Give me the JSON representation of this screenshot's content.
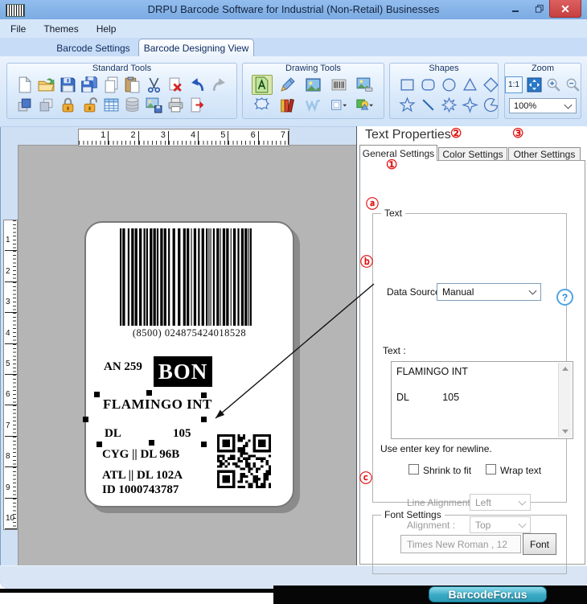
{
  "window": {
    "title": "DRPU Barcode Software for Industrial (Non-Retail) Businesses"
  },
  "menu": {
    "items": [
      "File",
      "Themes",
      "Help"
    ]
  },
  "main_tabs": {
    "barcode_settings": "Barcode Settings",
    "designing_view": "Barcode Designing View"
  },
  "toolbar": {
    "selected_tool": "text-tool",
    "zoom_ratio": "1:1",
    "zoom_level": "100%",
    "groups": [
      {
        "label": "Standard Tools",
        "icons": [
          "new-document",
          "open-file",
          "save",
          "save-as",
          "copy",
          "paste",
          "cut",
          "delete",
          "undo",
          "redo",
          "bring-to-front",
          "send-to-back",
          "lock",
          "unlock",
          "table",
          "database",
          "export-image",
          "print",
          "exit"
        ]
      },
      {
        "label": "Drawing Tools",
        "icons": [
          "text-tool",
          "pencil",
          "picture",
          "barcode-tool",
          "image-export",
          "shape-tool",
          "library",
          "watermark-tool",
          "frame-dropdown",
          "shapes-dropdown"
        ]
      },
      {
        "label": "Shapes",
        "icons": [
          "shape-rectangle",
          "shape-rounded-rectangle",
          "shape-ellipse",
          "shape-triangle",
          "shape-diamond",
          "shape-star",
          "shape-line",
          "shape-burst",
          "shape-star4",
          "shape-pacman"
        ]
      },
      {
        "label": "Zoom"
      }
    ]
  },
  "rulers": {
    "horizontal": [
      1,
      2,
      3,
      4,
      5,
      6,
      7
    ],
    "vertical": [
      1,
      2,
      3,
      4,
      5,
      6,
      7,
      8,
      9,
      10
    ]
  },
  "design_label": {
    "barcode_value": "(8500) 024875424018528",
    "line_an": "AN 259",
    "badge": "BON",
    "company": "FLAMINGO INT",
    "dl": "DL",
    "dl_num": "105",
    "line_cyg": "CYG || DL 96B",
    "line_atl": "ATL || DL 102A",
    "line_id": "ID 1000743787"
  },
  "panel": {
    "title": "Text Properties",
    "tabs": [
      "General Settings",
      "Color Settings",
      "Other Settings"
    ],
    "marks": {
      "n1": "①",
      "n2": "②",
      "n3": "③",
      "a": "ⓐ",
      "b": "ⓑ",
      "c": "ⓒ"
    },
    "text_group": {
      "label": "Text",
      "data_source_label": "Data Source :",
      "data_source_value": "Manual",
      "help_glyph": "?",
      "text_label": "Text :",
      "text_value": "FLAMINGO INT\n\nDL            105",
      "hint": "Use enter key for newline.",
      "shrink_label": "Shrink to fit",
      "wrap_label": "Wrap text",
      "line_alignment_label": "Line Alignment",
      "line_alignment_value": "Left",
      "alignment_label": "Alignment :",
      "alignment_value": "Top"
    },
    "font_group": {
      "label": "Font Settings",
      "font_value": "Times New Roman , 12",
      "font_button": "Font"
    }
  },
  "watermark": "BarcodeFor.us"
}
